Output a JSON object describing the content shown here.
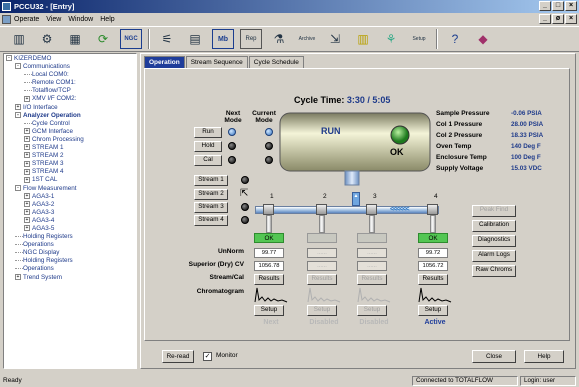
{
  "window": {
    "title": "PCCU32 - [Entry]",
    "min": "_",
    "max": "□",
    "close": "×",
    "inner_min": "_",
    "inner_max": "ø",
    "inner_close": "×"
  },
  "menu": [
    "Operate",
    "View",
    "Window",
    "Help"
  ],
  "toolbar": {
    "icons": [
      "entry-icon",
      "tools-icon",
      "nodes-icon",
      "refresh-icon",
      "ngc-icon",
      "trend-icon",
      "print-icon",
      "mb-icon",
      "report-icon",
      "calibrate-icon",
      "archive-icon",
      "collect-icon",
      "parameter-icon",
      "protocol-icon",
      "setup-icon",
      "help-icon",
      "exit-icon"
    ],
    "ngc_label": "NGC",
    "mb_label": "Mb",
    "setup_label": "Setup",
    "archive_label": "Archive",
    "report_label": "Rep"
  },
  "tree": [
    {
      "t": "KIZERDEMO",
      "d": 0,
      "x": "-"
    },
    {
      "t": "Communications",
      "d": 1,
      "x": "-"
    },
    {
      "t": "Local COM0:",
      "d": 2
    },
    {
      "t": "Remote COM1:",
      "d": 2
    },
    {
      "t": "Totalflow/TCP",
      "d": 2
    },
    {
      "t": "XMV I/F COM2:",
      "d": 2,
      "x": "+"
    },
    {
      "t": "I/O Interface",
      "d": 1,
      "x": "+"
    },
    {
      "t": "Analyzer Operation",
      "d": 1,
      "x": "-",
      "b": true
    },
    {
      "t": "Cycle Control",
      "d": 2
    },
    {
      "t": "GCM Interface",
      "d": 2,
      "x": "+"
    },
    {
      "t": "Chrom Processing",
      "d": 2,
      "x": "+"
    },
    {
      "t": "STREAM 1",
      "d": 2,
      "x": "+"
    },
    {
      "t": "STREAM 2",
      "d": 2,
      "x": "+"
    },
    {
      "t": "STREAM 3",
      "d": 2,
      "x": "+"
    },
    {
      "t": "STREAM 4",
      "d": 2,
      "x": "+"
    },
    {
      "t": "1ST CAL",
      "d": 2,
      "x": "+"
    },
    {
      "t": "Flow Measurement",
      "d": 1,
      "x": "-"
    },
    {
      "t": "AGA3-1",
      "d": 2,
      "x": "+"
    },
    {
      "t": "AGA3-2",
      "d": 2,
      "x": "+"
    },
    {
      "t": "AGA3-3",
      "d": 2,
      "x": "+"
    },
    {
      "t": "AGA3-4",
      "d": 2,
      "x": "+"
    },
    {
      "t": "AGA3-5",
      "d": 2,
      "x": "+"
    },
    {
      "t": "Holding Registers",
      "d": 1
    },
    {
      "t": "Operations",
      "d": 1
    },
    {
      "t": "NGC Display",
      "d": 1
    },
    {
      "t": "Holding Registers",
      "d": 1
    },
    {
      "t": "Operations",
      "d": 1
    },
    {
      "t": "Trend System",
      "d": 1,
      "x": "+"
    }
  ],
  "tabs": [
    "Operation",
    "Stream Sequence",
    "Cycle Schedule"
  ],
  "modes": {
    "next": "Next",
    "current": "Current",
    "mode": "Mode",
    "run": "Run",
    "hold": "Hold",
    "cal": "Cal"
  },
  "cycle": {
    "label": "Cycle Time:",
    "value": "3:30 / 5:05"
  },
  "analyzer": {
    "run": "RUN",
    "ok": "OK"
  },
  "streams": [
    "Stream 1",
    "Stream 2",
    "Stream 3",
    "Stream 4"
  ],
  "readings": [
    {
      "label": "Sample Pressure",
      "value": "-0.06 PSIA"
    },
    {
      "label": "Col 1 Pressure",
      "value": "28.00 PSIA"
    },
    {
      "label": "Col 2 Pressure",
      "value": "18.33 PSIA"
    },
    {
      "label": "Oven Temp",
      "value": "140 Deg F"
    },
    {
      "label": "Enclosure Temp",
      "value": "100 Deg F"
    },
    {
      "label": "Supply Voltage",
      "value": "15.03 VDC"
    }
  ],
  "side_buttons": [
    "Peak Find",
    "Calibration",
    "Diagnostics",
    "Alarm Logs",
    "Raw Chroms"
  ],
  "row_labels": [
    "UnNorm",
    "Superior (Dry) CV",
    "Stream/Cal",
    "Chromatogram"
  ],
  "columns": [
    {
      "num": "1",
      "ok": "OK",
      "unnorm": "99.77",
      "cv": "1056.78",
      "results": "Results",
      "setup": "Setup",
      "state": "Next",
      "enabled": true
    },
    {
      "num": "2",
      "ok": "",
      "unnorm": "......",
      "cv": "......",
      "results": "Results",
      "setup": "Setup",
      "state": "Disabled",
      "enabled": false
    },
    {
      "num": "3",
      "ok": "",
      "unnorm": "......",
      "cv": "......",
      "results": "Results",
      "setup": "Setup",
      "state": "Disabled",
      "enabled": false
    },
    {
      "num": "4",
      "ok": "OK",
      "unnorm": "99.72",
      "cv": "1056.72",
      "results": "Results",
      "setup": "Setup",
      "state": "Active",
      "enabled": true
    }
  ],
  "bottom": {
    "reread": "Re-read",
    "monitor": "Monitor",
    "close": "Close",
    "help": "Help"
  },
  "statusbar": {
    "ready": "Ready",
    "connection": "Connected to TOTALFLOW",
    "login": "Login: user"
  },
  "colors": {
    "accent": "#1f3d9a",
    "ok": "#53c653",
    "value_blue": "#1e3a8a"
  }
}
